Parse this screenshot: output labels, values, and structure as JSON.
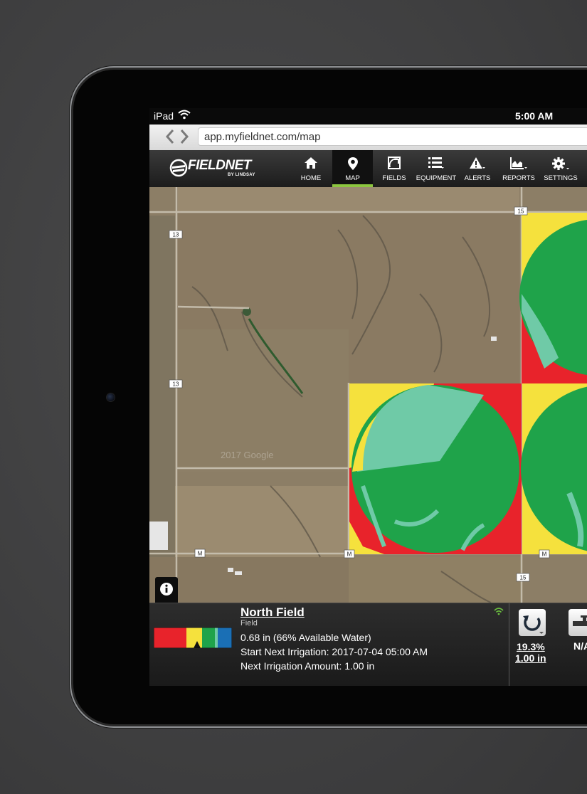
{
  "status_bar": {
    "carrier": "iPad",
    "time": "5:00 AM"
  },
  "browser": {
    "url": "app.myfieldnet.com/map"
  },
  "app": {
    "logo_text": "FIELDNET",
    "logo_sub": "BY LINDSAY"
  },
  "nav": {
    "items": [
      {
        "label": "HOME",
        "icon": "home-icon",
        "active": false
      },
      {
        "label": "MAP",
        "icon": "map-pin-icon",
        "active": true
      },
      {
        "label": "FIELDS",
        "icon": "fields-icon",
        "active": false
      },
      {
        "label": "EQUIPMENT",
        "icon": "equipment-list-icon",
        "active": false
      },
      {
        "label": "ALERTS",
        "icon": "alert-icon",
        "active": false
      },
      {
        "label": "REPORTS",
        "icon": "reports-chart-icon",
        "active": false
      },
      {
        "label": "SETTINGS",
        "icon": "gear-icon",
        "active": false
      }
    ]
  },
  "map": {
    "road_labels": [
      "15",
      "13",
      "13",
      "M",
      "M",
      "M",
      "15"
    ],
    "watermark": "2017 Google",
    "colors": {
      "deficit_red": "#e8232b",
      "caution_yellow": "#f5e13d",
      "optimal_green": "#1fa34a",
      "light_green": "#6fcaa7"
    }
  },
  "field_panel": {
    "name": "North Field",
    "type": "Field",
    "available_water": "0.68 in (66% Available Water)",
    "start_next_irrigation": "Start Next Irrigation: 2017-07-04 05:00 AM",
    "next_irrigation_amount": "Next Irrigation Amount: 1.00 in",
    "legend_colors": [
      "#e8232b",
      "#f5e13d",
      "#1fa34a",
      "#1a6fb5"
    ]
  },
  "equipment_panel": {
    "percent": "19.3%",
    "amount": "1.00 in",
    "second_status": "N/A"
  }
}
